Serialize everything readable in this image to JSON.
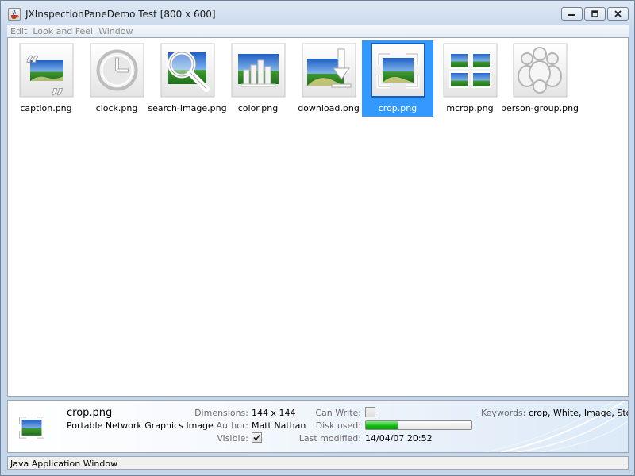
{
  "window": {
    "title": "JXInspectionPaneDemo Test [800 x 600]"
  },
  "menu": [
    {
      "label": "Edit"
    },
    {
      "label": "Look and Feel"
    },
    {
      "label": "Window"
    }
  ],
  "thumbnails": [
    {
      "label": "caption.png",
      "icon": "caption-icon"
    },
    {
      "label": "clock.png",
      "icon": "clock-icon"
    },
    {
      "label": "search-image.png",
      "icon": "search-image-icon"
    },
    {
      "label": "color.png",
      "icon": "color-icon"
    },
    {
      "label": "download.png",
      "icon": "download-icon"
    },
    {
      "label": "crop.png",
      "icon": "crop-icon",
      "selected": true
    },
    {
      "label": "mcrop.png",
      "icon": "mcrop-icon"
    },
    {
      "label": "person-group.png",
      "icon": "person-group-icon"
    }
  ],
  "inspector": {
    "name": "crop.png",
    "type": "Portable Network Graphics Image",
    "dimensions_label": "Dimensions:",
    "dimensions": "144 x 144",
    "author_label": "Author:",
    "author": "Matt Nathan",
    "visible_label": "Visible:",
    "visible": true,
    "can_write_label": "Can Write:",
    "can_write": false,
    "disk_used_label": "Disk used:",
    "disk_used_fraction": 0.3,
    "last_modified_label": "Last modified:",
    "last_modified": "14/04/07 20:52",
    "keywords_label": "Keywords:",
    "keywords": "crop, White, Image, Stock"
  },
  "status": {
    "text": "Java Application Window"
  },
  "colors": {
    "selection": "#3399ff",
    "progress": "#18c018"
  }
}
